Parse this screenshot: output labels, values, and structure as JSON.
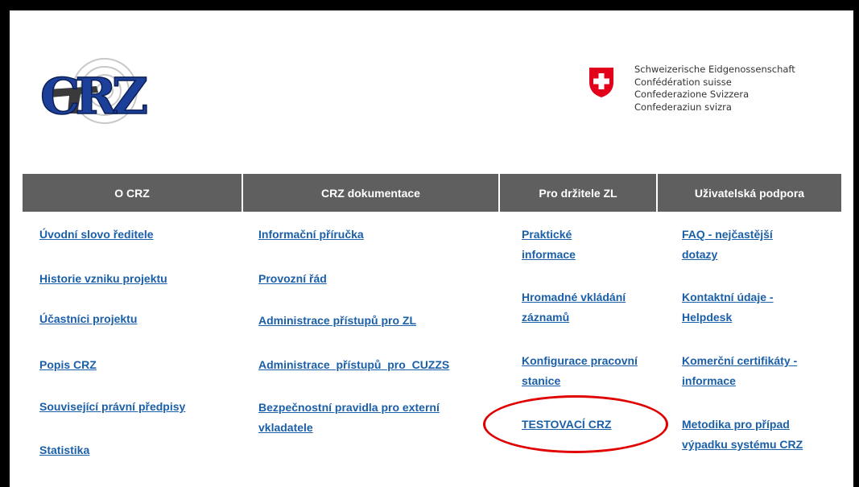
{
  "logo": {
    "text": "CRZ"
  },
  "confederation": {
    "lines": [
      "Schweizerische Eidgenossenschaft",
      "Confédération suisse",
      "Confederazione Svizzera",
      "Confederaziun svizra"
    ],
    "flag_color": "#e2001a"
  },
  "nav": {
    "headers": [
      "O CRZ",
      "CRZ dokumentace",
      "Pro držitele ZL",
      "Uživatelská podpora"
    ],
    "bg_color": "#5f5f5f"
  },
  "columns": {
    "ocrz": [
      "Úvodní slovo ředitele",
      "Historie vzniku projektu",
      "Účastníci projektu",
      "Popis CRZ",
      "Související právní předpisy",
      "Statistika"
    ],
    "dokumentace": [
      "Informační příručka",
      "Provozní řád",
      "Administrace přístupů pro ZL",
      "Administrace  přístupů  pro  CUZZS",
      "Bezpečnostní pravidla pro externí vkladatele"
    ],
    "drzitele": [
      "Praktické informace",
      "Hromadné vkládání záznamů",
      "Konfigurace pracovní stanice",
      "TESTOVACÍ CRZ"
    ],
    "podpora": [
      "FAQ - nejčastější dotazy",
      "Kontaktní údaje - Helpdesk",
      "Komerční certifikáty - informace",
      "Metodika pro případ výpadku systému CRZ"
    ]
  },
  "link_color": "#1a5fa8",
  "highlight_color": "#e00000"
}
